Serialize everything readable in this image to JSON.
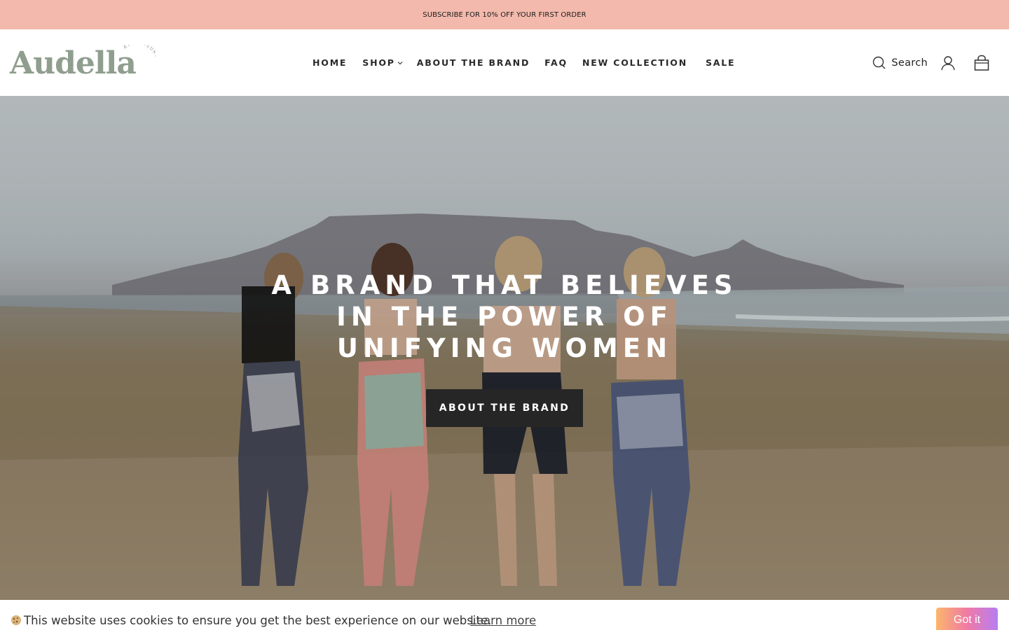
{
  "colors": {
    "announcement_bg": "#f2b9ac",
    "logo": "#8f9e8e",
    "nav_text": "#2a2a2a",
    "cta_bg": "#262626",
    "cookie_btn_gradient": [
      "#fbb66b",
      "#f07aa5",
      "#b77df3"
    ]
  },
  "announcement": {
    "text": "SUBSCRIBE FOR 10% OFF YOUR FIRST ORDER"
  },
  "header": {
    "logo": {
      "word": "Audella",
      "tagline": "ATHLEISURE"
    },
    "nav": [
      {
        "label": "HOME",
        "icon": null
      },
      {
        "label": "SHOP",
        "icon": "chevron-down-icon"
      },
      {
        "label": "ABOUT THE BRAND",
        "icon": null
      },
      {
        "label": "FAQ",
        "icon": null
      },
      {
        "label": "NEW COLLECTION",
        "icon": null
      },
      {
        "label": "SALE",
        "icon": null
      }
    ],
    "search": {
      "label": "Search",
      "icon": "search-icon"
    },
    "account_icon": "user-icon",
    "cart_icon": "shopping-bag-icon"
  },
  "hero": {
    "title_lines": [
      "A BRAND THAT BELIEVES",
      "IN THE POWER OF",
      "UNIFYING WOMEN"
    ],
    "cta_label": "ABOUT THE BRAND"
  },
  "cookie_banner": {
    "icon": "cookie-icon",
    "text": "This website uses cookies to ensure you get the best experience on our website.",
    "link_label": "Learn more",
    "button_label": "Got it"
  }
}
